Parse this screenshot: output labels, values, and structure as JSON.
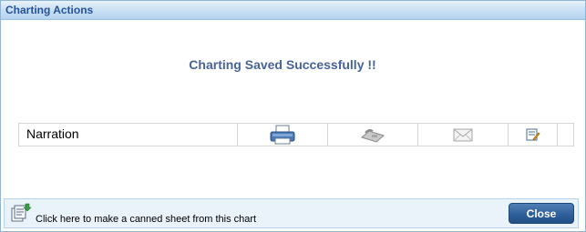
{
  "dialog": {
    "title": "Charting Actions",
    "message": "Charting Saved Successfully !!"
  },
  "actions": {
    "narration_label": "Narration",
    "icons": [
      "print-icon",
      "fax-icon",
      "email-icon",
      "edit-icon"
    ]
  },
  "footer": {
    "canned_sheet_text": "Click here to make a canned sheet from this chart",
    "close_label": "Close"
  }
}
